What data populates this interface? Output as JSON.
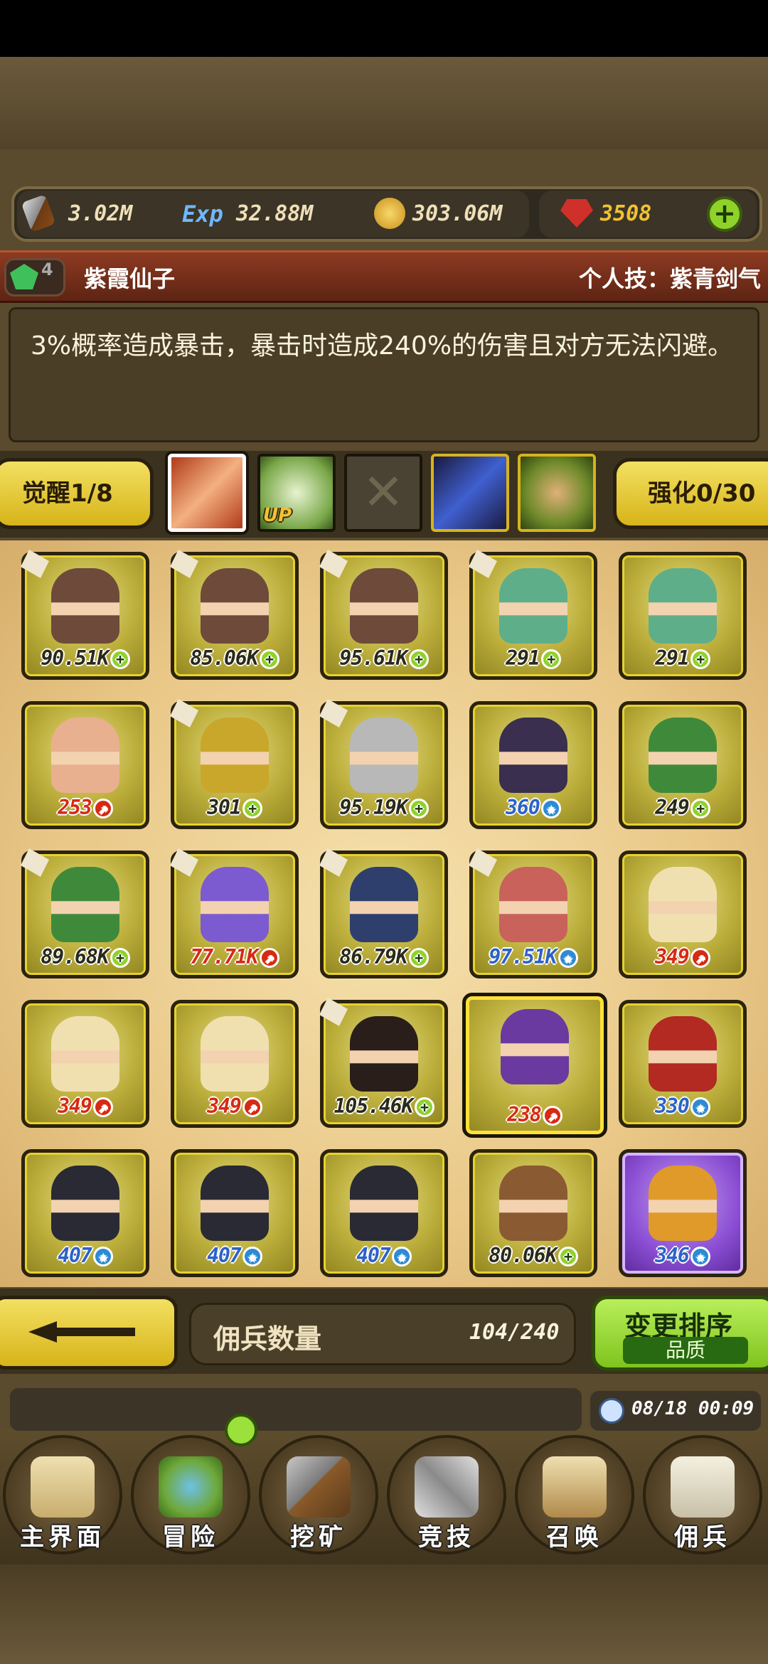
{
  "resources": {
    "attack": "3.02M",
    "exp_icon": "Exp",
    "exp": "32.88M",
    "gold": "303.06M",
    "gems": "3508"
  },
  "hero": {
    "level": "4",
    "name": "紫霞仙子",
    "skill_label": "个人技：紫青剑气",
    "description": "3%概率造成暴击，暴击时造成240%的伤害且对方无法闪避。"
  },
  "skills": {
    "awaken_label": "觉醒1/8",
    "enhance_label": "强化0/30",
    "up_label": "UP"
  },
  "units": [
    {
      "value": "90.51K",
      "badge": "plus",
      "color": "dark",
      "tint": "#6e4a3a"
    },
    {
      "value": "85.06K",
      "badge": "plus",
      "color": "dark",
      "tint": "#6e4a3a"
    },
    {
      "value": "95.61K",
      "badge": "plus",
      "color": "dark",
      "tint": "#6e4a3a"
    },
    {
      "value": "291",
      "badge": "plus",
      "color": "dark",
      "tint": "#5fae8a"
    },
    {
      "value": "291",
      "badge": "plus",
      "color": "dark",
      "tint": "#5fae8a"
    },
    {
      "value": "253",
      "badge": "red",
      "color": "red",
      "tint": "#e8b08e"
    },
    {
      "value": "301",
      "badge": "plus",
      "color": "dark",
      "tint": "#c9a72a"
    },
    {
      "value": "95.19K",
      "badge": "plus",
      "color": "dark",
      "tint": "#b8b8b8"
    },
    {
      "value": "360",
      "badge": "blue",
      "color": "blue",
      "tint": "#3a2f4e"
    },
    {
      "value": "249",
      "badge": "plus",
      "color": "dark",
      "tint": "#3f8a3a"
    },
    {
      "value": "89.68K",
      "badge": "plus",
      "color": "dark",
      "tint": "#3f8a3a"
    },
    {
      "value": "77.71K",
      "badge": "red",
      "color": "red",
      "tint": "#7c5ad0"
    },
    {
      "value": "86.79K",
      "badge": "plus",
      "color": "dark",
      "tint": "#2e3f6e"
    },
    {
      "value": "97.51K",
      "badge": "blue",
      "color": "blue",
      "tint": "#c8625a"
    },
    {
      "value": "349",
      "badge": "red",
      "color": "red",
      "tint": "#f0e0b0"
    },
    {
      "value": "349",
      "badge": "red",
      "color": "red",
      "tint": "#f0e0b0"
    },
    {
      "value": "349",
      "badge": "red",
      "color": "red",
      "tint": "#f0e0b0"
    },
    {
      "value": "105.46K",
      "badge": "plus",
      "color": "dark",
      "tint": "#2a1e1a"
    },
    {
      "value": "238",
      "badge": "red",
      "color": "red",
      "tint": "#6a3aa0"
    },
    {
      "value": "330",
      "badge": "blue",
      "color": "blue",
      "tint": "#b22a22"
    },
    {
      "value": "407",
      "badge": "blue",
      "color": "blue",
      "tint": "#2a2a35"
    },
    {
      "value": "407",
      "badge": "blue",
      "color": "blue",
      "tint": "#2a2a35"
    },
    {
      "value": "407",
      "badge": "blue",
      "color": "blue",
      "tint": "#2a2a35"
    },
    {
      "value": "80.06K",
      "badge": "plus",
      "color": "dark",
      "tint": "#8a5a32"
    },
    {
      "value": "346",
      "badge": "blue",
      "color": "blue",
      "tint": "#e09a2a"
    }
  ],
  "footer": {
    "count_label": "佣兵数量",
    "count_value": "104/240",
    "sort_label": "变更排序",
    "sort_mode": "品质",
    "time": "08/18 00:09"
  },
  "nav": [
    "主界面",
    "冒险",
    "挖矿",
    "竞技",
    "召唤",
    "佣兵"
  ]
}
